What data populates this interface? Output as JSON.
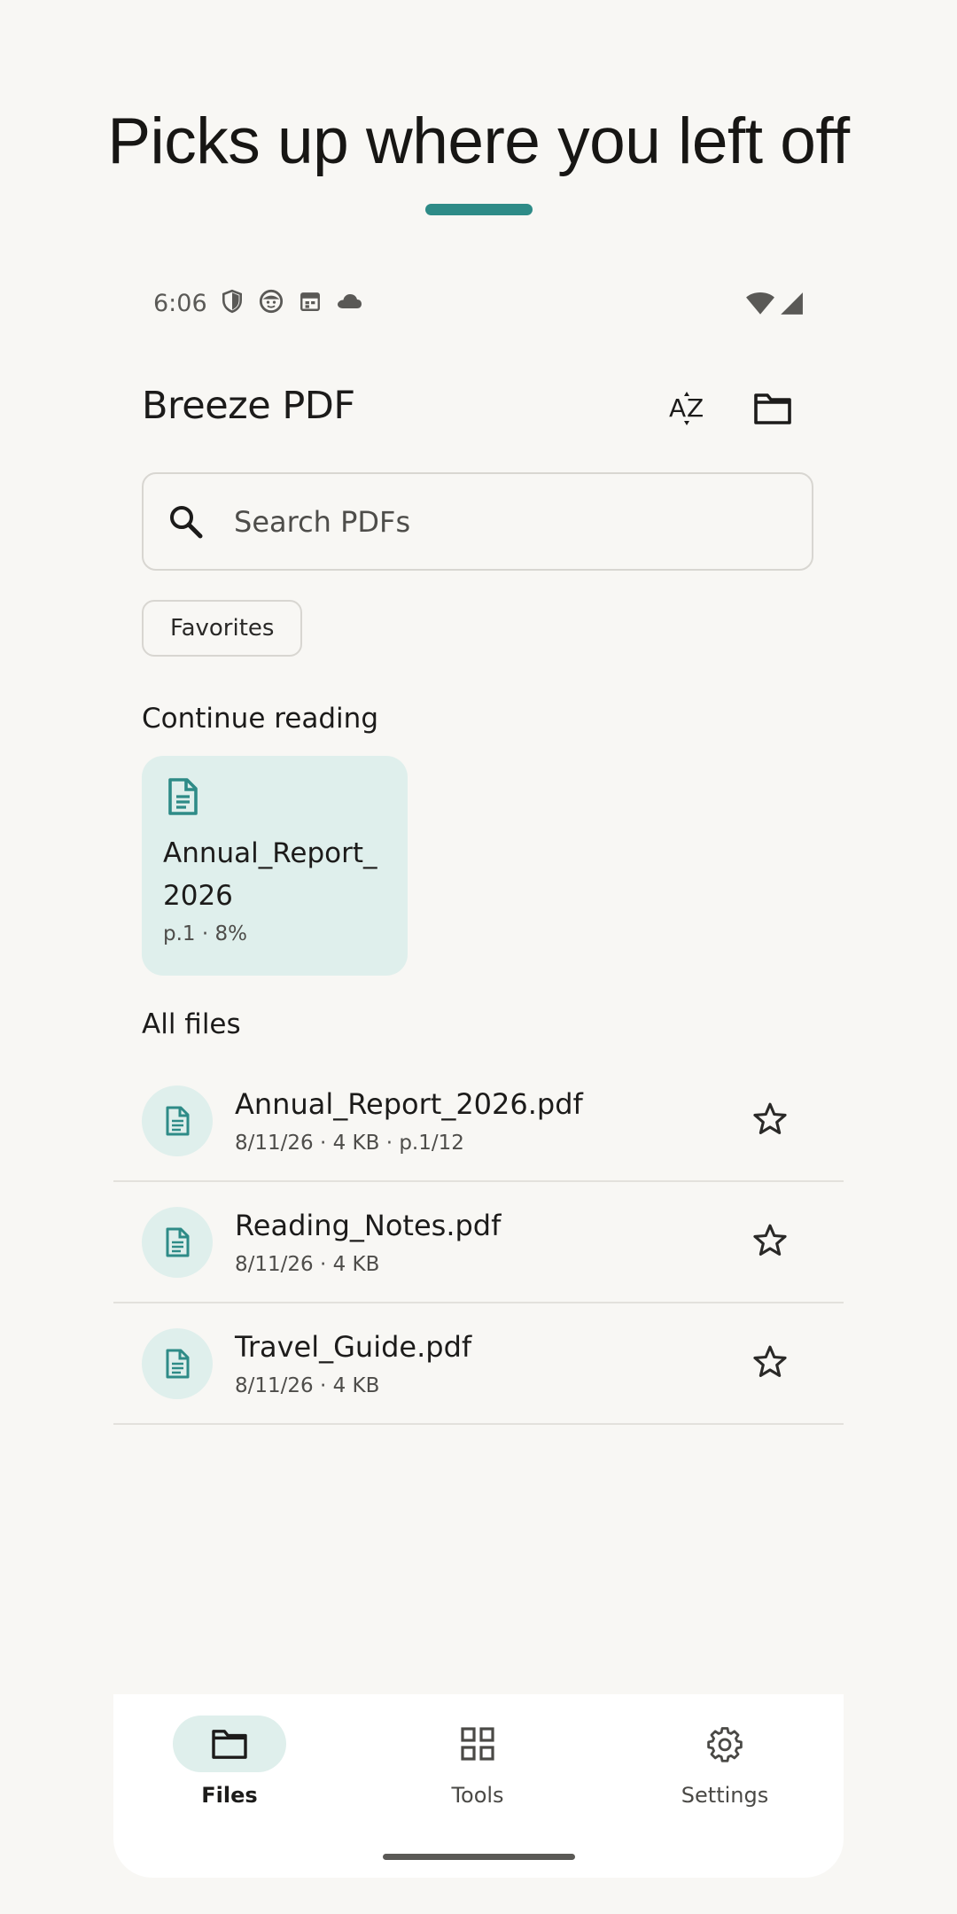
{
  "headline": "Picks up where you left off",
  "colors": {
    "accent": "#2e8b87",
    "accent_soft": "#dfefec",
    "background": "#f8f7f4"
  },
  "status_bar": {
    "time": "6:06",
    "icons": [
      "shield-icon",
      "emoji-icon",
      "calendar-icon",
      "cloud-icon"
    ],
    "right_icons": [
      "wifi-icon",
      "signal-icon"
    ]
  },
  "app": {
    "title": "Breeze PDF",
    "sort_icon": "sort-az-icon",
    "folder_icon": "folder-icon"
  },
  "search": {
    "placeholder": "Search PDFs",
    "value": ""
  },
  "filter_chip": "Favorites",
  "continue_reading": {
    "label": "Continue reading",
    "card": {
      "title": "Annual_Report_2026",
      "meta": "p.1 · 8%"
    }
  },
  "all_files": {
    "label": "All files",
    "files": [
      {
        "name": "Annual_Report_2026.pdf",
        "meta": "8/11/26 · 4 KB · p.1/12"
      },
      {
        "name": "Reading_Notes.pdf",
        "meta": "8/11/26 · 4 KB"
      },
      {
        "name": "Travel_Guide.pdf",
        "meta": "8/11/26 · 4 KB"
      }
    ]
  },
  "bottom_nav": {
    "items": [
      {
        "label": "Files",
        "icon": "folder-icon",
        "active": true
      },
      {
        "label": "Tools",
        "icon": "grid-icon",
        "active": false
      },
      {
        "label": "Settings",
        "icon": "gear-icon",
        "active": false
      }
    ]
  }
}
